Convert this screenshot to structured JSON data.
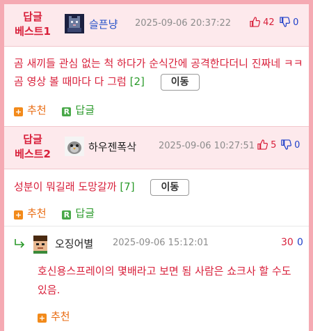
{
  "best1": {
    "label_line1": "답글",
    "label_line2": "베스트1",
    "nick": "슬픈냥",
    "date": "2025-09-06 20:37:22",
    "up_count": "42",
    "down_count": "0",
    "content": "곰 새끼들 관심 없는 척 하다가 순식간에 공격한다더니 진짜네 ㅋㅋ 곰 영상 볼 때마다 다 그럼",
    "reply_count": "[2]",
    "move_label": "이동",
    "recommend_label": "추천",
    "reply_label": "답글"
  },
  "best2": {
    "label_line1": "답글",
    "label_line2": "베스트2",
    "nick": "하우젠폭삭",
    "date": "2025-09-06 10:27:51",
    "up_count": "5",
    "down_count": "0",
    "content": "성분이 뭐길래 도망갈까",
    "reply_count": "[7]",
    "move_label": "이동",
    "recommend_label": "추천",
    "reply_label": "답글"
  },
  "reply": {
    "nick": "오징어별",
    "date": "2025-09-06 15:12:01",
    "up_count": "30",
    "down_count": "0",
    "content": "호신용스프레이의 몇배라고 보면 됨 사람은 쇼크사 할 수도 있음.",
    "recommend_label": "추천"
  },
  "colors": {
    "accent_red": "#d81f3a",
    "down_blue": "#1e3fc9",
    "reply_green": "#2a9a2a",
    "recommend_orange": "#e86a0f",
    "frame_pink": "#f5aab3",
    "header_bg": "#fde9ec"
  }
}
